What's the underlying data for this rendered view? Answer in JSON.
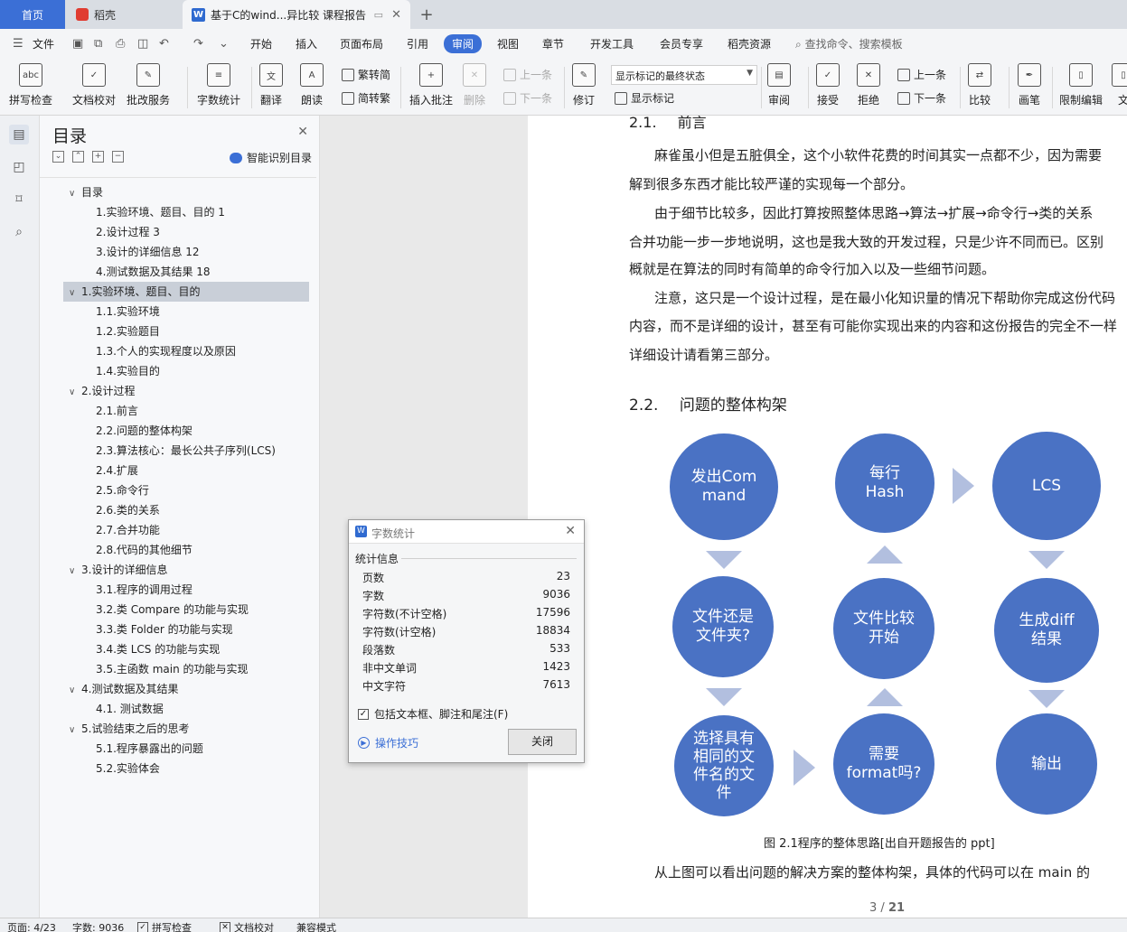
{
  "tabs": {
    "home": "首页",
    "shell": "稻壳",
    "doc": "基于C的wind...异比较 课程报告",
    "add": "+"
  },
  "menu": {
    "file": "文件",
    "items": [
      "开始",
      "插入",
      "页面布局",
      "引用",
      "审阅",
      "视图",
      "章节",
      "开发工具",
      "会员专享",
      "稻壳资源"
    ],
    "active": "审阅",
    "search": "查找命令、搜索模板"
  },
  "ribbon": {
    "spell": "拼写检查",
    "doc_check": "文档校对",
    "annotate_service": "批改服务",
    "word_count": "字数统计",
    "translate": "翻译",
    "read_aloud": "朗读",
    "trad_to_simp": "繁转简",
    "simp_to_trad": "简转繁",
    "insert_comment": "插入批注",
    "delete": "删除",
    "prev_comment": "上一条",
    "next_comment": "下一条",
    "track": "修订",
    "markup_state": "显示标记的最终状态",
    "show_markup": "显示标记",
    "review": "审阅",
    "accept": "接受",
    "reject": "拒绝",
    "prev_change": "上一条",
    "next_change": "下一条",
    "compare": "比较",
    "pen": "画笔",
    "restrict_edit": "限制编辑",
    "doc_cut": "文"
  },
  "toc": {
    "title": "目录",
    "smart": "智能识别目录",
    "items": [
      {
        "label": "目录",
        "level": 1,
        "expanded": true
      },
      {
        "label": "1.实验环境、题目、目的  1",
        "level": 2
      },
      {
        "label": "2.设计过程  3",
        "level": 2
      },
      {
        "label": "3.设计的详细信息  12",
        "level": 2
      },
      {
        "label": "4.测试数据及其结果  18",
        "level": 2
      },
      {
        "label": "1.实验环境、题目、目的",
        "level": 1,
        "expanded": true,
        "selected": true
      },
      {
        "label": "1.1.实验环境",
        "level": 2
      },
      {
        "label": "1.2.实验题目",
        "level": 2
      },
      {
        "label": "1.3.个人的实现程度以及原因",
        "level": 2
      },
      {
        "label": "1.4.实验目的",
        "level": 2
      },
      {
        "label": "2.设计过程",
        "level": 1,
        "expanded": true
      },
      {
        "label": "2.1.前言",
        "level": 2
      },
      {
        "label": "2.2.问题的整体构架",
        "level": 2
      },
      {
        "label": "2.3.算法核心：最长公共子序列(LCS)",
        "level": 2
      },
      {
        "label": "2.4.扩展",
        "level": 2
      },
      {
        "label": "2.5.命令行",
        "level": 2
      },
      {
        "label": "2.6.类的关系",
        "level": 2
      },
      {
        "label": "2.7.合并功能",
        "level": 2
      },
      {
        "label": "2.8.代码的其他细节",
        "level": 2
      },
      {
        "label": "3.设计的详细信息",
        "level": 1,
        "expanded": true
      },
      {
        "label": "3.1.程序的调用过程",
        "level": 2
      },
      {
        "label": "3.2.类 Compare 的功能与实现",
        "level": 2
      },
      {
        "label": "3.3.类 Folder 的功能与实现",
        "level": 2
      },
      {
        "label": "3.4.类 LCS 的功能与实现",
        "level": 2
      },
      {
        "label": "3.5.主函数 main 的功能与实现",
        "level": 2
      },
      {
        "label": "4.测试数据及其结果",
        "level": 1,
        "expanded": true
      },
      {
        "label": "4.1. 测试数据",
        "level": 2
      },
      {
        "label": "5.试验结束之后的思考",
        "level": 1,
        "expanded": true
      },
      {
        "label": "5.1.程序暴露出的问题",
        "level": 2
      },
      {
        "label": "5.2.实验体会",
        "level": 2
      }
    ]
  },
  "document": {
    "top_heading_num": "2.1.",
    "top_heading": "前言",
    "paragraphs": [
      "麻雀虽小但是五脏俱全，这个小软件花费的时间其实一点都不少，因为需要",
      "解到很多东西才能比较严谨的实现每一个部分。",
      "由于细节比较多，因此打算按照整体思路→算法→扩展→命令行→类的关系",
      "合并功能一步一步地说明，这也是我大致的开发过程，只是少许不同而已。区别",
      "概就是在算法的同时有简单的命令行加入以及一些细节问题。",
      "注意，这只是一个设计过程，是在最小化知识量的情况下帮助你完成这份代码",
      "内容，而不是详细的设计，甚至有可能你实现出来的内容和这份报告的完全不一样",
      "详细设计请看第三部分。"
    ],
    "section_num": "2.2.",
    "section_title": "问题的整体构架",
    "diagram": {
      "send_command": "发出Command",
      "hash": "每行Hash",
      "lcs": "LCS",
      "file_or_folder": "文件还是文件夹?",
      "compare_start": "文件比较开始",
      "gen_diff": "生成diff结果",
      "select_same": "选择具有相同的文件名的文件",
      "need_format": "需要format吗?",
      "output": "输出"
    },
    "caption": "图 2.1程序的整体思路[出自开题报告的 ppt]",
    "last_line": "从上图可以看出问题的解决方案的整体构架，具体的代码可以在 main 的",
    "page_num": "3",
    "page_total": "21"
  },
  "dialog": {
    "title": "字数统计",
    "section": "统计信息",
    "stats": [
      {
        "k": "页数",
        "v": "23"
      },
      {
        "k": "字数",
        "v": "9036"
      },
      {
        "k": "字符数(不计空格)",
        "v": "17596"
      },
      {
        "k": "字符数(计空格)",
        "v": "18834"
      },
      {
        "k": "段落数",
        "v": "533"
      },
      {
        "k": "非中文单词",
        "v": "1423"
      },
      {
        "k": "中文字符",
        "v": "7613"
      }
    ],
    "include_label": "包括文本框、脚注和尾注(F)",
    "include_checked": true,
    "tips": "操作技巧",
    "close": "关闭"
  },
  "status": {
    "page": "页面: 4/23",
    "words": "字数: 9036",
    "spell": "拼写检查",
    "doc_check": "文档校对",
    "compat": "兼容模式"
  }
}
